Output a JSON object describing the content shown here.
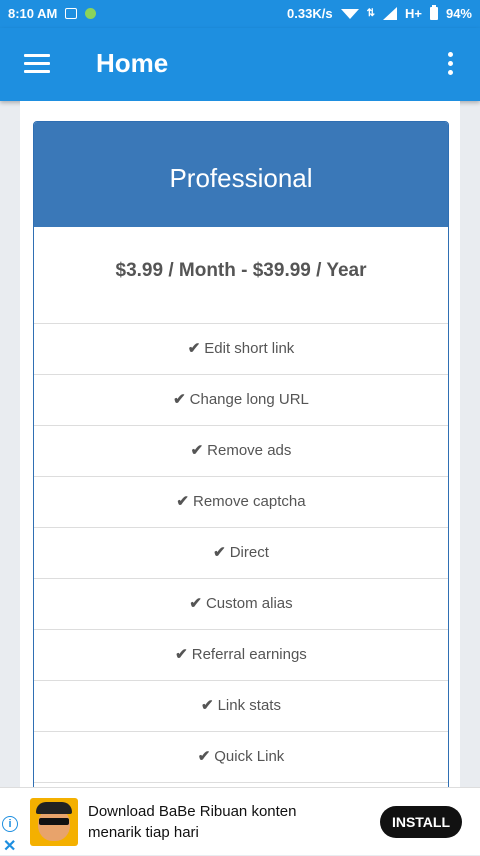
{
  "status_bar": {
    "time": "8:10 AM",
    "network_speed": "0.33K/s",
    "network_type": "H+",
    "battery": "94%"
  },
  "app_bar": {
    "title": "Home"
  },
  "plan": {
    "name": "Professional",
    "price": "$3.99 / Month - $39.99 / Year",
    "check_glyph": "✔",
    "features": [
      "Edit short link",
      "Change long URL",
      "Remove ads",
      "Remove captcha",
      "Direct",
      "Custom alias",
      "Referral earnings",
      "Link stats",
      "Quick Link"
    ]
  },
  "ad": {
    "text": "Download BaBe Ribuan konten menarik tiap hari",
    "button_label": "INSTALL",
    "info_glyph": "i",
    "close_glyph": "✕"
  },
  "colors": {
    "primary": "#1e8fe0",
    "card_header": "#3a78b8"
  }
}
